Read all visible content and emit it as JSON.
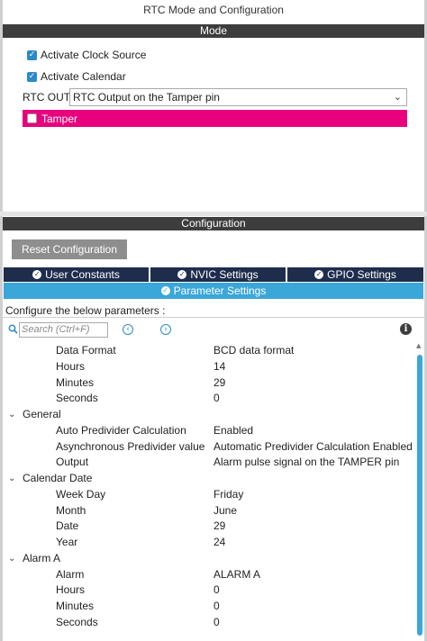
{
  "window": {
    "title": "RTC Mode and Configuration"
  },
  "mode": {
    "header": "Mode",
    "activate_clock_source": {
      "label": "Activate Clock Source",
      "checked": true
    },
    "activate_calendar": {
      "label": "Activate Calendar",
      "checked": true
    },
    "rtc_out": {
      "label": "RTC OUT",
      "selected": "RTC Output on the Tamper pin"
    },
    "tamper": {
      "label": "Tamper",
      "checked": false
    }
  },
  "configuration": {
    "header": "Configuration",
    "reset_button": "Reset Configuration",
    "tabs": [
      {
        "label": "User Constants",
        "active": false
      },
      {
        "label": "NVIC Settings",
        "active": false
      },
      {
        "label": "GPIO Settings",
        "active": false
      },
      {
        "label": "Parameter Settings",
        "active": true
      }
    ],
    "instruction": "Configure the below parameters :",
    "search": {
      "placeholder": "Search (Ctrl+F)"
    }
  },
  "params": [
    {
      "type": "param",
      "name": "Data Format",
      "value": "BCD data format"
    },
    {
      "type": "param",
      "name": "Hours",
      "value": "14"
    },
    {
      "type": "param",
      "name": "Minutes",
      "value": "29"
    },
    {
      "type": "param",
      "name": "Seconds",
      "value": "0"
    },
    {
      "type": "group",
      "name": "General"
    },
    {
      "type": "param",
      "name": "Auto Predivider Calculation",
      "value": "Enabled"
    },
    {
      "type": "param",
      "name": "Asynchronous Predivider value",
      "value": "Automatic Predivider Calculation Enabled"
    },
    {
      "type": "param",
      "name": "Output",
      "value": "Alarm pulse signal on the TAMPER pin"
    },
    {
      "type": "group",
      "name": "Calendar Date"
    },
    {
      "type": "param",
      "name": "Week Day",
      "value": "Friday"
    },
    {
      "type": "param",
      "name": "Month",
      "value": "June"
    },
    {
      "type": "param",
      "name": "Date",
      "value": "29"
    },
    {
      "type": "param",
      "name": "Year",
      "value": "24"
    },
    {
      "type": "group",
      "name": "Alarm A"
    },
    {
      "type": "param",
      "name": "Alarm",
      "value": "ALARM A"
    },
    {
      "type": "param",
      "name": "Hours",
      "value": "0"
    },
    {
      "type": "param",
      "name": "Minutes",
      "value": "0"
    },
    {
      "type": "param",
      "name": "Seconds",
      "value": "0"
    }
  ],
  "colors": {
    "section_bar": "#3d3d3d",
    "accent_blue": "#3aa7d8",
    "tab_dark": "#1f2d4d",
    "tamper_pink": "#e8007d"
  }
}
